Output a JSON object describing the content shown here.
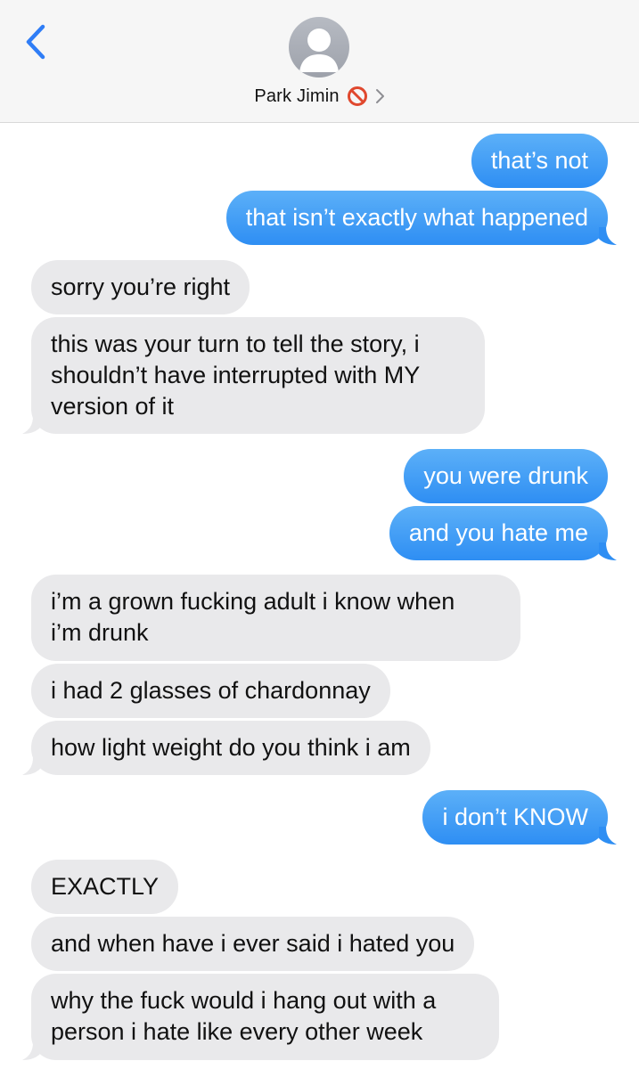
{
  "header": {
    "contact_name": "Park Jimin",
    "back_icon": "chevron-left-icon",
    "status_icon": "blocked-icon",
    "disclosure_icon": "chevron-right-icon"
  },
  "colors": {
    "sent_bubble": "#3a96f4",
    "received_bubble": "#e9e9eb",
    "accent": "#2f7df6"
  },
  "messages": [
    {
      "from": "me",
      "lines": [
        "that’s not"
      ]
    },
    {
      "from": "me",
      "lines": [
        "that isn’t exactly what happened"
      ]
    },
    {
      "from": "them",
      "lines": [
        "sorry you’re right"
      ]
    },
    {
      "from": "them",
      "lines": [
        "this was your turn to tell the story, i",
        "shouldn’t have interrupted with MY",
        "version of it"
      ]
    },
    {
      "from": "me",
      "lines": [
        "you were drunk"
      ]
    },
    {
      "from": "me",
      "lines": [
        "and you hate me"
      ]
    },
    {
      "from": "them",
      "lines": [
        "i’m a grown fucking adult i know when",
        "i’m drunk"
      ]
    },
    {
      "from": "them",
      "lines": [
        "i had 2 glasses of chardonnay"
      ]
    },
    {
      "from": "them",
      "lines": [
        "how light weight do you think i am"
      ]
    },
    {
      "from": "me",
      "lines": [
        "i don’t KNOW"
      ]
    },
    {
      "from": "them",
      "lines": [
        "EXACTLY"
      ]
    },
    {
      "from": "them",
      "lines": [
        "and when have i ever said i hated you"
      ]
    },
    {
      "from": "them",
      "lines": [
        "why the fuck would i hang out with a",
        "person i hate like every other week"
      ]
    }
  ]
}
